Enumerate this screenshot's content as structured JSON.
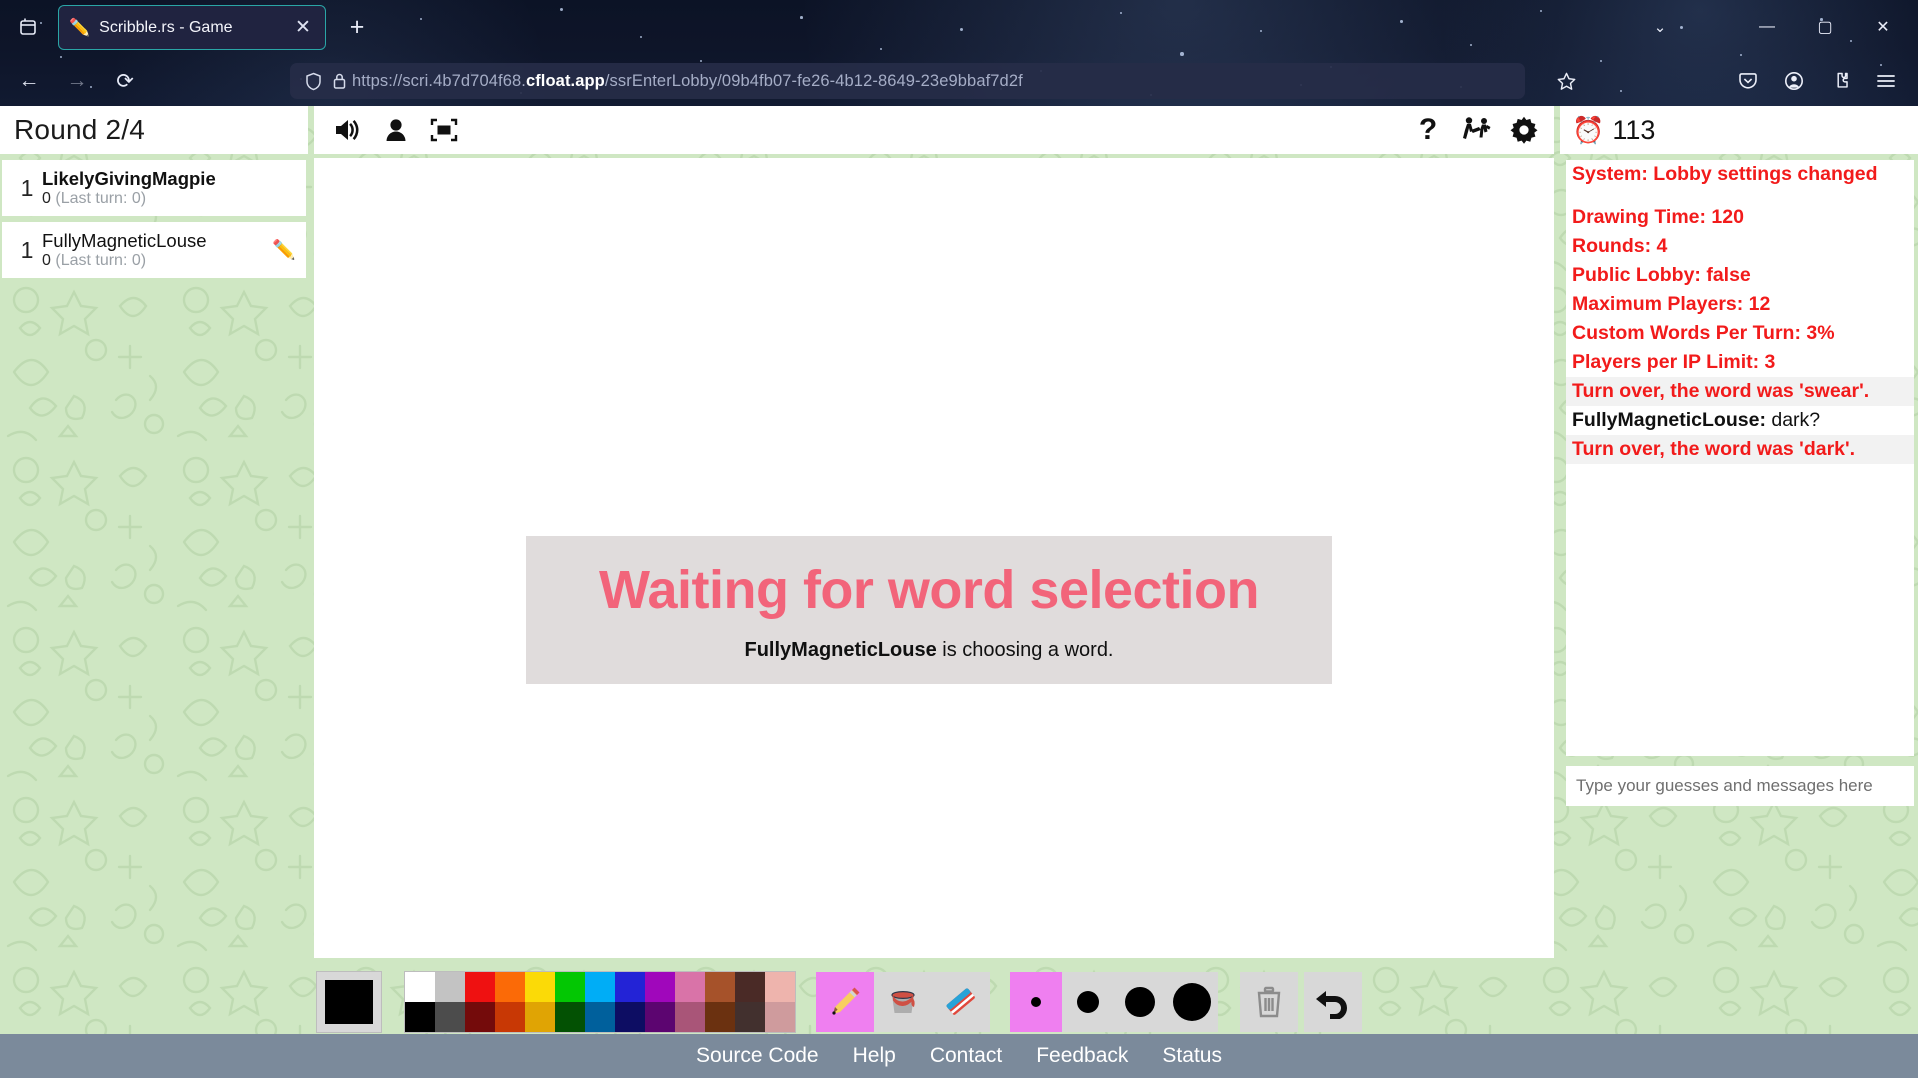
{
  "browser": {
    "firefox_view_icon": "firefox-view-icon",
    "tab": {
      "favicon": "✏️",
      "title": "Scribble.rs - Game",
      "close_label": "✕"
    },
    "new_tab_label": "+",
    "tab_list_label": "⌄",
    "window_controls": {
      "minimize": "—",
      "maximize": "▢",
      "close": "✕"
    },
    "nav": {
      "back": "←",
      "forward": "→",
      "reload": "⟳"
    },
    "url": {
      "prefix": "https://scri.4b7d704f68.",
      "host": "cfloat.app",
      "path": "/ssrEnterLobby/09b4fb07-fe26-4b12-8649-23e9bbaf7d2f",
      "full": "https://scri.4b7d704f68.cfloat.app/ssrEnterLobby/09b4fb07-fe26-4b12-8649-23e9bbaf7d2f"
    },
    "toolbar_icons": [
      "bookmark-star-icon",
      "pocket-icon",
      "account-icon",
      "extensions-icon",
      "app-menu-icon"
    ]
  },
  "game": {
    "round_label": "Round 2/4",
    "players": [
      {
        "rank": "1",
        "name": "LikelyGivingMagpie",
        "score": "0",
        "last_turn": "(Last turn: 0)",
        "is_me": true,
        "is_drawing": false
      },
      {
        "rank": "1",
        "name": "FullyMagneticLouse",
        "score": "0",
        "last_turn": "(Last turn: 0)",
        "is_me": false,
        "is_drawing": true
      }
    ],
    "drawing_pencil": "✏️",
    "toolbar_left": [
      {
        "name": "sound-toggle-icon",
        "glyph": "🔊"
      },
      {
        "name": "player-list-toggle-icon",
        "glyph": "👤"
      },
      {
        "name": "fullscreen-icon",
        "glyph": "⛶"
      }
    ],
    "toolbar_right": [
      {
        "name": "help-icon",
        "glyph": "?"
      },
      {
        "name": "kick-player-icon",
        "glyph": "kick"
      },
      {
        "name": "settings-gear-icon",
        "glyph": "⚙"
      }
    ],
    "canvas": {
      "waiting_title": "Waiting for word selection",
      "waiting_sub_name": "FullyMagneticLouse",
      "waiting_sub_rest": " is choosing a word."
    },
    "timer": {
      "icon": "⏰",
      "value": "113"
    }
  },
  "tools": {
    "current_color": "#000000",
    "palette": [
      [
        "#ffffff",
        "#000000"
      ],
      [
        "#c3c3c3",
        "#4c4c4c"
      ],
      [
        "#ef1111",
        "#740b0b"
      ],
      [
        "#fb6a07",
        "#c83805"
      ],
      [
        "#fbda07",
        "#e0a404"
      ],
      [
        "#03c703",
        "#035103"
      ],
      [
        "#00adf6",
        "#00609c"
      ],
      [
        "#2323d6",
        "#0d0d63"
      ],
      [
        "#a007bb",
        "#5c0570"
      ],
      [
        "#d973a8",
        "#a95578"
      ],
      [
        "#a6522a",
        "#6b3110"
      ],
      [
        "#4a2a26",
        "#42302e"
      ],
      [
        "#eeb4ad",
        "#cf9b9d"
      ]
    ],
    "buttons": [
      {
        "name": "pencil-tool",
        "glyph": "✏️",
        "active": true
      },
      {
        "name": "fill-bucket-tool",
        "glyph": "bucket",
        "active": false
      },
      {
        "name": "eraser-tool",
        "glyph": "eraser",
        "active": false
      }
    ],
    "sizes": [
      {
        "name": "brush-size-1",
        "dot": 10,
        "active": true
      },
      {
        "name": "brush-size-2",
        "dot": 22,
        "active": false
      },
      {
        "name": "brush-size-3",
        "dot": 30,
        "active": false
      },
      {
        "name": "brush-size-4",
        "dot": 38,
        "active": false
      }
    ],
    "clear_label": "🗑",
    "undo_label": "↩"
  },
  "chat": {
    "messages": [
      {
        "type": "system",
        "text": "System: Lobby settings changed",
        "alt": false
      },
      {
        "type": "spacer"
      },
      {
        "type": "system",
        "text": "Drawing Time: 120",
        "alt": false
      },
      {
        "type": "system",
        "text": "Rounds: 4",
        "alt": false
      },
      {
        "type": "system",
        "text": "Public Lobby: false",
        "alt": false
      },
      {
        "type": "system",
        "text": "Maximum Players: 12",
        "alt": false
      },
      {
        "type": "system",
        "text": "Custom Words Per Turn: 3%",
        "alt": false
      },
      {
        "type": "system",
        "text": "Players per IP Limit: 3",
        "alt": false
      },
      {
        "type": "system",
        "text": "Turn over, the word was 'swear'.",
        "alt": true
      },
      {
        "type": "user",
        "sender": "FullyMagneticLouse:",
        "text": " dark?",
        "alt": false
      },
      {
        "type": "system",
        "text": "Turn over, the word was 'dark'.",
        "alt": true
      }
    ],
    "input_placeholder": "Type your guesses and messages here",
    "input_value": ""
  },
  "footer": {
    "links": [
      "Source Code",
      "Help",
      "Contact",
      "Feedback",
      "Status"
    ]
  },
  "colors": {
    "page_bg": "#cfe7c3",
    "panel_bg": "#ffffff",
    "system_msg": "#f21b1b",
    "waiting_title": "#f2647a",
    "footer_bg": "#7b8a9b",
    "tool_active": "#ef7ff0"
  }
}
